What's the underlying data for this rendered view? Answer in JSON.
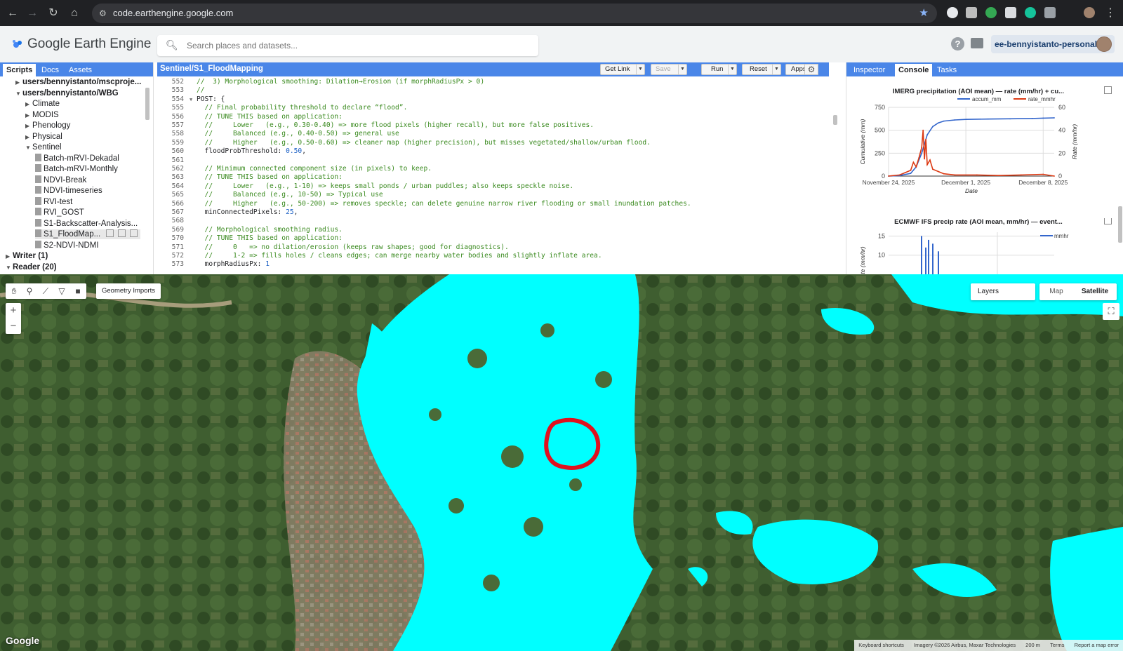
{
  "browser": {
    "url": "code.earthengine.google.com"
  },
  "header": {
    "logo": "Google Earth Engine",
    "search_placeholder": "Search places and datasets...",
    "account": "ee-bennyistanto-personal"
  },
  "left_panel": {
    "tabs": [
      "Scripts",
      "Docs",
      "Assets"
    ],
    "active_tab": "Scripts",
    "tree": [
      {
        "label": "users/bennyistanto/mscproje...",
        "level": 1,
        "expanded": false,
        "bold": true
      },
      {
        "label": "users/bennyistanto/WBG",
        "level": 1,
        "expanded": true,
        "bold": true
      },
      {
        "label": "Climate",
        "level": 2,
        "expanded": false
      },
      {
        "label": "MODIS",
        "level": 2,
        "expanded": false
      },
      {
        "label": "Phenology",
        "level": 2,
        "expanded": false
      },
      {
        "label": "Physical",
        "level": 2,
        "expanded": false
      },
      {
        "label": "Sentinel",
        "level": 2,
        "expanded": true
      },
      {
        "label": "Batch-mRVI-Dekadal",
        "level": 3,
        "file": true
      },
      {
        "label": "Batch-mRVI-Monthly",
        "level": 3,
        "file": true
      },
      {
        "label": "NDVI-Break",
        "level": 3,
        "file": true
      },
      {
        "label": "NDVI-timeseries",
        "level": 3,
        "file": true
      },
      {
        "label": "RVI-test",
        "level": 3,
        "file": true
      },
      {
        "label": "RVI_GOST",
        "level": 3,
        "file": true
      },
      {
        "label": "S1-Backscatter-Analysis...",
        "level": 3,
        "file": true
      },
      {
        "label": "S1_FloodMap...",
        "level": 3,
        "file": true,
        "selected": true
      },
      {
        "label": "S2-NDVI-NDMI",
        "level": 3,
        "file": true
      },
      {
        "label": "Writer (1)",
        "level": 0,
        "expanded": false,
        "bold": true
      },
      {
        "label": "Reader (20)",
        "level": 0,
        "expanded": true,
        "bold": true
      }
    ]
  },
  "editor": {
    "title": "Sentinel/S1_FloodMapping",
    "buttons": {
      "get_link": "Get Link",
      "save": "Save",
      "run": "Run",
      "reset": "Reset",
      "apps": "Apps"
    },
    "lines": [
      {
        "n": "552",
        "segs": [
          {
            "c": "cm",
            "t": "//  3) Morphological smoothing: Dilation→Erosion (if morphRadiusPx > 0)"
          }
        ]
      },
      {
        "n": "553",
        "segs": [
          {
            "c": "cm",
            "t": "//"
          }
        ]
      },
      {
        "n": "554",
        "fold": true,
        "segs": [
          {
            "c": "kw",
            "t": "POST: {"
          }
        ]
      },
      {
        "n": "555",
        "segs": [
          {
            "c": "cm",
            "t": "  // Final probability threshold to declare “flood”."
          }
        ]
      },
      {
        "n": "556",
        "segs": [
          {
            "c": "cm",
            "t": "  // TUNE THIS based on application:"
          }
        ]
      },
      {
        "n": "557",
        "segs": [
          {
            "c": "cm",
            "t": "  //     Lower   (e.g., 0.30-0.40) => more flood pixels (higher recall), but more false positives."
          }
        ]
      },
      {
        "n": "558",
        "segs": [
          {
            "c": "cm",
            "t": "  //     Balanced (e.g., 0.40-0.50) => general use"
          }
        ]
      },
      {
        "n": "559",
        "segs": [
          {
            "c": "cm",
            "t": "  //     Higher   (e.g., 0.50-0.60) => cleaner map (higher precision), but misses vegetated/shallow/urban flood."
          }
        ]
      },
      {
        "n": "560",
        "segs": [
          {
            "c": "kw",
            "t": "  floodProbThreshold: "
          },
          {
            "c": "num",
            "t": "0.50"
          },
          {
            "c": "kw",
            "t": ","
          }
        ]
      },
      {
        "n": "561",
        "segs": []
      },
      {
        "n": "562",
        "segs": [
          {
            "c": "cm",
            "t": "  // Minimum connected component size (in pixels) to keep."
          }
        ]
      },
      {
        "n": "563",
        "segs": [
          {
            "c": "cm",
            "t": "  // TUNE THIS based on application:"
          }
        ]
      },
      {
        "n": "564",
        "segs": [
          {
            "c": "cm",
            "t": "  //     Lower   (e.g., 1-10) => keeps small ponds / urban puddles; also keeps speckle noise."
          }
        ]
      },
      {
        "n": "565",
        "segs": [
          {
            "c": "cm",
            "t": "  //     Balanced (e.g., 10-50) => Typical use"
          }
        ]
      },
      {
        "n": "566",
        "segs": [
          {
            "c": "cm",
            "t": "  //     Higher   (e.g., 50-200) => removes speckle; can delete genuine narrow river flooding or small inundation patches."
          }
        ]
      },
      {
        "n": "567",
        "segs": [
          {
            "c": "kw",
            "t": "  minConnectedPixels: "
          },
          {
            "c": "num",
            "t": "25"
          },
          {
            "c": "kw",
            "t": ","
          }
        ]
      },
      {
        "n": "568",
        "segs": []
      },
      {
        "n": "569",
        "segs": [
          {
            "c": "cm",
            "t": "  // Morphological smoothing radius."
          }
        ]
      },
      {
        "n": "570",
        "segs": [
          {
            "c": "cm",
            "t": "  // TUNE THIS based on application:"
          }
        ]
      },
      {
        "n": "571",
        "segs": [
          {
            "c": "cm",
            "t": "  //     0   => no dilation/erosion (keeps raw shapes; good for diagnostics)."
          }
        ]
      },
      {
        "n": "572",
        "segs": [
          {
            "c": "cm",
            "t": "  //     1-2 => fills holes / cleans edges; can merge nearby water bodies and slightly inflate area."
          }
        ]
      },
      {
        "n": "573",
        "segs": [
          {
            "c": "kw",
            "t": "  morphRadiusPx: "
          },
          {
            "c": "num",
            "t": "1"
          }
        ]
      }
    ]
  },
  "right_panel": {
    "tabs": [
      "Inspector",
      "Console",
      "Tasks"
    ],
    "active_tab": "Console"
  },
  "chart_data": [
    {
      "type": "line",
      "title": "IMERG precipitation (AOI mean) — rate (mm/hr) + cu...",
      "xlabel": "Date",
      "ylabel": "Cumulative (mm)",
      "ylabel_right": "Rate (mm/hr)",
      "x_ticks": [
        "November 24, 2025",
        "December 1, 2025",
        "December 8, 2025"
      ],
      "y_ticks": [
        "0",
        "250",
        "500",
        "750"
      ],
      "y_ticks_right": [
        "0",
        "20",
        "40",
        "60"
      ],
      "ylim": [
        0,
        750
      ],
      "ylim_right": [
        0,
        60
      ],
      "legend": "top-right",
      "grid": true,
      "series": [
        {
          "name": "accum_mm",
          "axis": "left",
          "color": "#3366cc",
          "x": [
            "2025-11-24",
            "2025-11-25",
            "2025-11-26",
            "2025-11-26T12:00",
            "2025-11-27",
            "2025-11-27T12:00",
            "2025-11-28",
            "2025-11-28T12:00",
            "2025-11-29",
            "2025-11-30",
            "2025-12-01",
            "2025-12-03",
            "2025-12-05",
            "2025-12-07",
            "2025-12-08",
            "2025-12-09"
          ],
          "values": [
            0,
            5,
            30,
            100,
            250,
            450,
            540,
            580,
            600,
            612,
            618,
            622,
            625,
            628,
            632,
            635
          ]
        },
        {
          "name": "rate_mmhr",
          "axis": "right",
          "color": "#dc3912",
          "x": [
            "2025-11-24",
            "2025-11-25",
            "2025-11-25T12:00",
            "2025-11-26",
            "2025-11-26T06:00",
            "2025-11-26T12:00",
            "2025-11-26T18:00",
            "2025-11-27",
            "2025-11-27T03:00",
            "2025-11-27T06:00",
            "2025-11-27T09:00",
            "2025-11-27T12:00",
            "2025-11-27T18:00",
            "2025-11-28",
            "2025-11-28T12:00",
            "2025-11-29",
            "2025-11-30",
            "2025-12-02",
            "2025-12-04",
            "2025-12-06",
            "2025-12-08",
            "2025-12-09"
          ],
          "values": [
            0,
            1,
            3,
            5,
            12,
            8,
            16,
            25,
            40,
            15,
            32,
            10,
            14,
            6,
            4,
            2,
            1,
            1,
            0.5,
            1,
            1.5,
            0
          ]
        }
      ]
    },
    {
      "type": "bar",
      "title": "ECMWF IFS precip rate (AOI mean, mm/hr) — event...",
      "ylabel": "te (mm/hr)",
      "y_ticks": [
        "15",
        "10"
      ],
      "legend": "top-right",
      "series": [
        {
          "name": "mmhr",
          "color": "#3366cc",
          "values": [
            15,
            12,
            14,
            13,
            11
          ]
        }
      ]
    }
  ],
  "map": {
    "geometry_imports": "Geometry Imports",
    "layers": "Layers",
    "map_type": [
      "Map",
      "Satellite"
    ],
    "active_map_type": "Satellite",
    "zoom_in": "+",
    "zoom_out": "−",
    "google_logo": "Google",
    "attribution": [
      "Keyboard shortcuts",
      "Imagery ©2026 Airbus, Maxar Technologies",
      "200 m",
      "Terms",
      "Report a map error"
    ],
    "colors": {
      "flood": "#00ffff",
      "highlight": "#e0101e",
      "vegetation": "#3d5a2e"
    }
  }
}
